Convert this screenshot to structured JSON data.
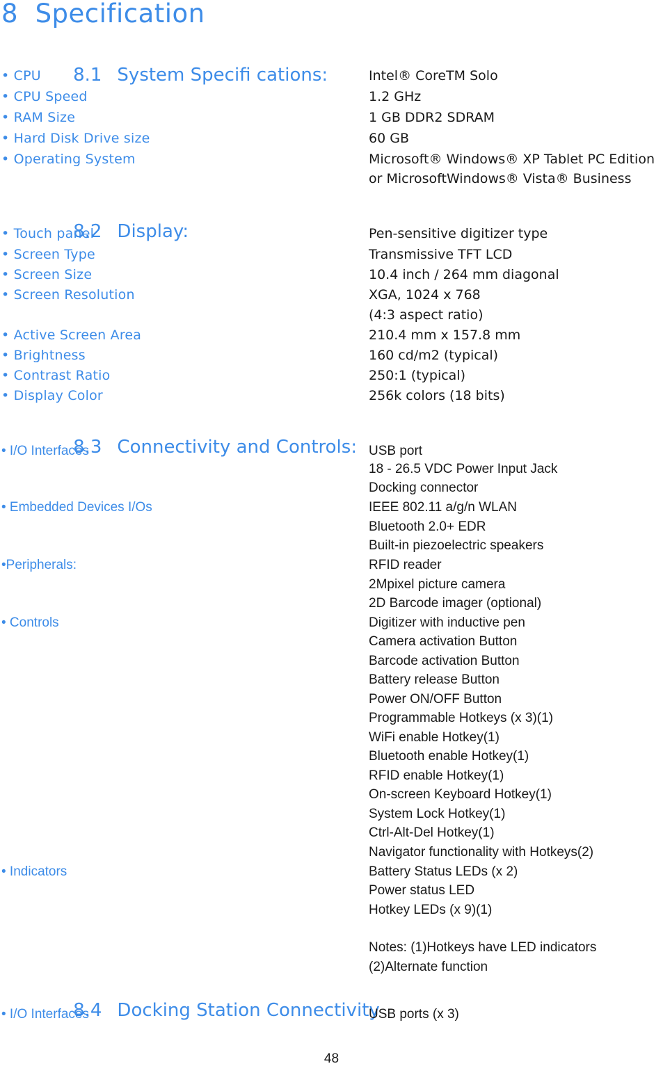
{
  "document": {
    "chapter_title": "8  Specification",
    "page_number": "48",
    "accent_color": "#3d8ce8",
    "text_color": "#1a1a1a"
  },
  "sections": [
    {
      "number": "8.1",
      "title": "System Specifi cations:"
    },
    {
      "number": "8.2",
      "title": "Display:"
    },
    {
      "number": "8.3",
      "title": "Connectivity and Controls:"
    },
    {
      "number": "8.4",
      "title": "Docking Station Connectivity"
    }
  ],
  "labels": {
    "cpu": "• CPU",
    "cpu_speed": "• CPU Speed",
    "ram_size": "• RAM Size",
    "hard_disk_drive_size": "• Hard Disk Drive size",
    "operating_system": "• Operating System",
    "touch_panel": "• Touch panel",
    "screen_type": "• Screen Type",
    "screen_size": "• Screen Size",
    "screen_resolution": "• Screen Resolution",
    "active_screen_area": "• Active Screen Area",
    "brightness": "• Brightness",
    "contrast_ratio": "• Contrast Ratio",
    "display_color": "• Display Color",
    "io_interfaces": "• I/O Interfaces",
    "embedded_devices": "• Embedded Devices I/Os",
    "peripherals": "•Peripherals:",
    "controls": "• Controls",
    "indicators": "• Indicators",
    "dock_io_interfaces": "• I/O Interfaces"
  },
  "values": {
    "cpu": "Intel® CoreTM Solo",
    "cpu_speed": "1.2 GHz",
    "ram_size": "1 GB DDR2 SDRAM",
    "hard_disk_drive_size": "60 GB",
    "operating_system_line1": "Microsoft® Windows® XP Tablet PC Edition",
    "operating_system_line2": "or MicrosoftWindows® Vista® Business",
    "touch_panel": "Pen-sensitive digitizer type",
    "screen_type": "Transmissive TFT LCD",
    "screen_size": "10.4 inch / 264 mm diagonal",
    "screen_resolution_line1": "XGA, 1024 x 768",
    "screen_resolution_line2": "(4:3 aspect ratio)",
    "active_screen_area": "210.4 mm x 157.8 mm",
    "brightness": "160 cd/m2 (typical)",
    "contrast_ratio": "250:1 (typical)",
    "display_color": "256k colors (18 bits)",
    "io_line1": "USB port",
    "io_line2": "18 - 26.5 VDC Power Input Jack",
    "io_line3": "Docking connector",
    "embedded_line1": "IEEE 802.11 a/g/n WLAN",
    "embedded_line2": "Bluetooth 2.0+ EDR",
    "embedded_line3": "Built-in piezoelectric speakers",
    "peripherals_line1": "RFID reader",
    "peripherals_line2": "2Mpixel picture camera",
    "peripherals_line3": "2D Barcode imager (optional)",
    "controls_line1": "Digitizer with inductive pen",
    "controls_line2": "Camera activation Button",
    "controls_line3": "Barcode activation Button",
    "controls_line4": "Battery release Button",
    "controls_line5": "Power ON/OFF Button",
    "controls_line6": "Programmable Hotkeys (x 3)(1)",
    "controls_line7": "WiFi enable Hotkey(1)",
    "controls_line8": "Bluetooth enable Hotkey(1)",
    "controls_line9": "RFID enable Hotkey(1)",
    "controls_line10": "On-screen Keyboard Hotkey(1)",
    "controls_line11": "System Lock Hotkey(1)",
    "controls_line12": "Ctrl-Alt-Del Hotkey(1)",
    "controls_line13": "Navigator functionality with Hotkeys(2)",
    "indicators_line1": "Battery Status LEDs (x 2)",
    "indicators_line2": "Power status LED",
    "indicators_line3": "Hotkey LEDs (x 9)(1)",
    "notes_line1": "Notes: (1)Hotkeys have LED indicators",
    "notes_line2": "(2)Alternate function",
    "dock_io_line1": "USB ports (x 3)"
  }
}
